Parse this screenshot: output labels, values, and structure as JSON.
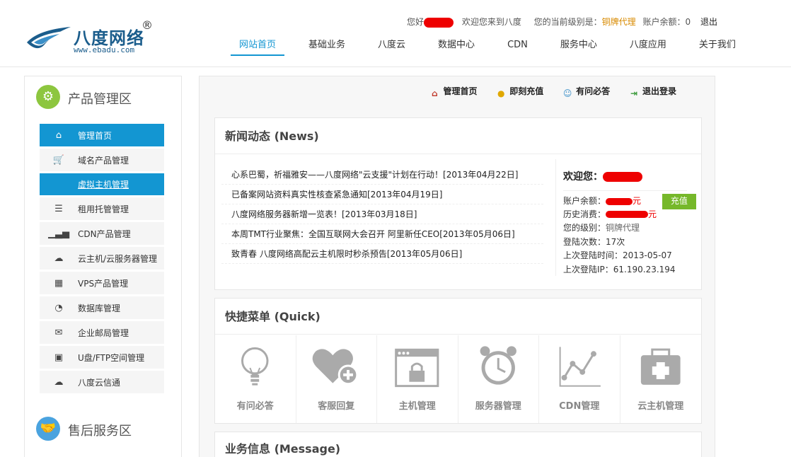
{
  "header": {
    "logo_text": "八度网络",
    "logo_reg": "®",
    "logo_url": "www.ebadu.com",
    "greeting_prefix": "您好",
    "welcome_text": "欢迎您来到八度",
    "level_label": "您的当前级别是：",
    "level_value": "铜牌代理",
    "balance_label": "账户余额：0",
    "logout": "退出"
  },
  "nav": {
    "items": [
      "网站首页",
      "基础业务",
      "八度云",
      "数据中心",
      "CDN",
      "服务中心",
      "八度应用",
      "关于我们"
    ]
  },
  "sidebar": {
    "title": "产品管理区",
    "items": [
      {
        "label": "管理首页",
        "icon": "home-icon"
      },
      {
        "label": "域名产品管理",
        "icon": "cart-icon"
      },
      {
        "label": "虚拟主机管理",
        "icon": "none"
      },
      {
        "label": "租用托管管理",
        "icon": "list-icon"
      },
      {
        "label": "CDN产品管理",
        "icon": "signal-icon"
      },
      {
        "label": "云主机/云服务器管理",
        "icon": "cloud-icon"
      },
      {
        "label": "VPS产品管理",
        "icon": "grid-list-icon"
      },
      {
        "label": "数据库管理",
        "icon": "pie-icon"
      },
      {
        "label": "企业邮局管理",
        "icon": "mail-icon"
      },
      {
        "label": "U盘/FTP空间管理",
        "icon": "disk-icon"
      },
      {
        "label": "八度云信通",
        "icon": "cloud-icon"
      }
    ],
    "after_sales_title": "售后服务区"
  },
  "toolbar": {
    "items": [
      {
        "label": "管理首页",
        "icon": "house-icon"
      },
      {
        "label": "即刻充值",
        "icon": "coins-icon"
      },
      {
        "label": "有问必答",
        "icon": "user-icon"
      },
      {
        "label": "退出登录",
        "icon": "exit-icon"
      }
    ]
  },
  "news": {
    "title": "新闻动态 (News)",
    "items": [
      "心系巴蜀，祈福雅安——八度网络\"云支援\"计划在行动！[2013年04月22日]",
      "已备案网站资料真实性核查紧急通知[2013年04月19日]",
      "八度网络服务器新增一览表！[2013年03月18日]",
      "本周TMT行业聚焦：全国互联网大会召开 阿里新任CEO[2013年05月06日]",
      "致青春 八度网络高配云主机限时秒杀预告[2013年05月06日]"
    ]
  },
  "user": {
    "welcome": "欢迎您：",
    "balance_label": "账户余额：",
    "balance_suffix": "元",
    "recharge": "充值",
    "history_label": "历史消费：",
    "history_suffix": "元",
    "level_label": "您的级别：",
    "level_value": "铜牌代理",
    "login_count": "登陆次数：17次",
    "last_login_time": "上次登陆时间：2013-05-07",
    "last_login_ip": "上次登陆IP：61.190.23.194"
  },
  "quick": {
    "title": "快捷菜单 (Quick)",
    "items": [
      {
        "label": "有问必答",
        "icon": "lightbulb-icon"
      },
      {
        "label": "客服回复",
        "icon": "heart-plus-icon"
      },
      {
        "label": "主机管理",
        "icon": "lock-window-icon"
      },
      {
        "label": "服务器管理",
        "icon": "alarm-clock-icon"
      },
      {
        "label": "CDN管理",
        "icon": "line-chart-icon"
      },
      {
        "label": "云主机管理",
        "icon": "first-aid-icon"
      }
    ]
  },
  "message": {
    "title": "业务信息 (Message)"
  },
  "colors": {
    "accent": "#1396d2",
    "green": "#8dc63f",
    "recharge": "#76b82a",
    "level": "#d88a00"
  }
}
